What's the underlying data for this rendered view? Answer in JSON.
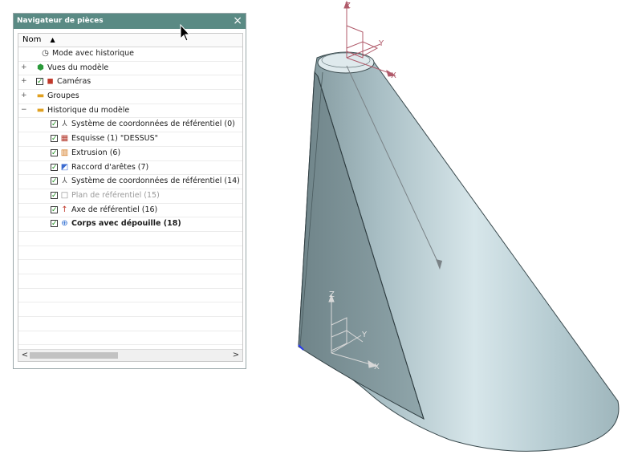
{
  "navigator": {
    "title": "Navigateur de pièces",
    "close": "×",
    "column_header": "Nom",
    "sort_icon": "triangle-up",
    "rows": [
      {
        "label": "Mode avec historique",
        "icon": "clock-icon",
        "expand": "",
        "check": false,
        "indent": 1
      },
      {
        "label": "Vues du modèle",
        "icon": "views-icon",
        "expand": "+",
        "check": false,
        "indent": 0
      },
      {
        "label": "Caméras",
        "icon": "camera-icon",
        "expand": "+",
        "check": true,
        "indent": 0
      },
      {
        "label": "Groupes",
        "icon": "folder-icon",
        "expand": "+",
        "check": false,
        "indent": 0
      },
      {
        "label": "Historique du modèle",
        "icon": "folder-open-icon",
        "expand": "−",
        "check": false,
        "indent": 0
      },
      {
        "label": "Système de coordonnées de référentiel (0)",
        "icon": "csys-icon",
        "expand": "",
        "check": true,
        "indent": 2
      },
      {
        "label": "Esquisse (1) \"DESSUS\"",
        "icon": "sketch-icon",
        "expand": "",
        "check": true,
        "indent": 2
      },
      {
        "label": "Extrusion (6)",
        "icon": "extrude-icon",
        "expand": "",
        "check": true,
        "indent": 2
      },
      {
        "label": "Raccord d'arêtes (7)",
        "icon": "blend-icon",
        "expand": "",
        "check": true,
        "indent": 2
      },
      {
        "label": "Système de coordonnées de référentiel (14)",
        "icon": "csys-icon",
        "expand": "",
        "check": true,
        "indent": 2
      },
      {
        "label": "Plan de référentiel (15)",
        "icon": "plane-icon",
        "expand": "",
        "check": true,
        "indent": 2,
        "dim": true
      },
      {
        "label": "Axe de référentiel (16)",
        "icon": "axis-icon",
        "expand": "",
        "check": true,
        "indent": 2
      },
      {
        "label": "Corps avec dépouille (18)",
        "icon": "draft-body-icon",
        "expand": "",
        "check": true,
        "indent": 2,
        "bold": true
      }
    ],
    "scroll_left": "<",
    "scroll_right": ">"
  },
  "viewport": {
    "axis_labels": {
      "z": "Z",
      "y": "Y",
      "x": "X"
    },
    "colors": {
      "body": "#b9d0d6",
      "edge": "#2e3c40",
      "triad_top": "#b05a6a",
      "triad_bottom": "#a9a9a9"
    }
  }
}
